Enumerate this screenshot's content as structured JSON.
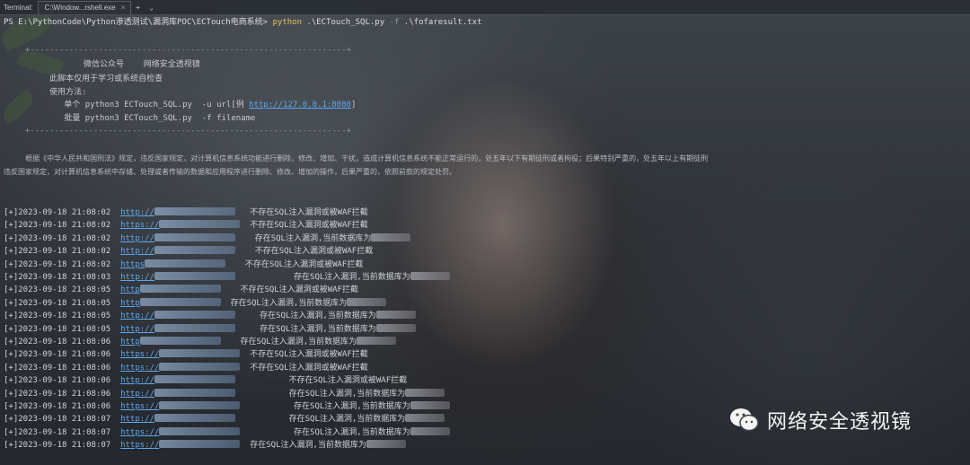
{
  "tabbar": {
    "label": "Terminal:",
    "tab_title": "C:\\Window...rshell.exe",
    "close_glyph": "×",
    "new_tab_glyph": "+",
    "dropdown_glyph": "⌄"
  },
  "command": {
    "prompt": "PS E:\\PythonCode\\Python渗透测试\\漏洞库POC\\ECTouch电商系统> ",
    "python": "python",
    "script": " .\\ECTouch_SQL.py ",
    "flag": "-f",
    "file": " .\\fofaresult.txt"
  },
  "banner": {
    "border": "+-----------------------------------------------------------------+",
    "line1": "            微信公众号    网络安全透视镜",
    "line2": "     此脚本仅用于学习或系统自检查",
    "line3": "     使用方法:",
    "line4_pre": "        单个 python3 ECTouch_SQL.py  -u url[例 ",
    "line4_link": "http://127.0.0.1:8080",
    "line4_post": "]",
    "line5": "        批量 python3 ECTouch_SQL.py  -f filename"
  },
  "legal": {
    "line1": "     根据《中华人民共和国刑法》规定，违反国家规定，对计算机信息系统功能进行删除、修改、增加、干扰，造成计算机信息系统不能正常运行的，处五年以下有期徒刑或者拘役；后果特别严重的，处五年以上有期徒刑",
    "line2": "违反国家规定，对计算机信息系统中存储、处理或者传输的数据和应用程序进行删除、修改、增加的操作，后果严重的，依照前款的规定处罚。"
  },
  "results": [
    {
      "prefix": "[+]2023-09-18 21:08:02",
      "url": "http://",
      "msg": "不存在SQL注入漏洞或被WAF拦截",
      "pad": "   "
    },
    {
      "prefix": "[+]2023-09-18 21:08:02",
      "url": "https://",
      "msg": "不存在SQL注入漏洞或被WAF拦截",
      "pad": "  "
    },
    {
      "prefix": "[+]2023-09-18 21:08:02",
      "url": "http://",
      "msg": "存在SQL注入漏洞,当前数据库为",
      "pad": "    "
    },
    {
      "prefix": "[+]2023-09-18 21:08:02",
      "url": "http://",
      "msg": "不存在SQL注入漏洞或被WAF拦截",
      "pad": "    "
    },
    {
      "prefix": "[+]2023-09-18 21:08:02",
      "url": "https",
      "msg": "不存在SQL注入漏洞或被WAF拦截",
      "pad": "    "
    },
    {
      "prefix": "[+]2023-09-18 21:08:03",
      "url": "http://",
      "msg": "存在SQL注入漏洞,当前数据库为",
      "pad": "            "
    },
    {
      "prefix": "[+]2023-09-18 21:08:05",
      "url": "http",
      "msg": "不存在SQL注入漏洞或被WAF拦截",
      "pad": "    "
    },
    {
      "prefix": "[+]2023-09-18 21:08:05",
      "url": "http",
      "msg": "存在SQL注入漏洞,当前数据库为",
      "pad": "  "
    },
    {
      "prefix": "[+]2023-09-18 21:08:05",
      "url": "http://",
      "msg": "存在SQL注入漏洞,当前数据库为",
      "pad": "     "
    },
    {
      "prefix": "[+]2023-09-18 21:08:05",
      "url": "http://",
      "msg": "存在SQL注入漏洞,当前数据库为",
      "pad": "     "
    },
    {
      "prefix": "[+]2023-09-18 21:08:06",
      "url": "http",
      "msg": "存在SQL注入漏洞,当前数据库为",
      "pad": "    "
    },
    {
      "prefix": "[+]2023-09-18 21:08:06",
      "url": "https://",
      "msg": "不存在SQL注入漏洞或被WAF拦截",
      "pad": "  "
    },
    {
      "prefix": "[+]2023-09-18 21:08:06",
      "url": "https://",
      "msg": "不存在SQL注入漏洞或被WAF拦截",
      "pad": "  "
    },
    {
      "prefix": "[+]2023-09-18 21:08:06",
      "url": "http://",
      "msg": "不存在SQL注入漏洞或被WAF拦截",
      "pad": "           "
    },
    {
      "prefix": "[+]2023-09-18 21:08:06",
      "url": "http://",
      "msg": "存在SQL注入漏洞,当前数据库为",
      "pad": "           "
    },
    {
      "prefix": "[+]2023-09-18 21:08:06",
      "url": "https://",
      "msg": "存在SQL注入漏洞,当前数据库为",
      "pad": "           "
    },
    {
      "prefix": "[+]2023-09-18 21:08:07",
      "url": "http://",
      "msg": "存在SQL注入漏洞,当前数据库为",
      "pad": "           "
    },
    {
      "prefix": "[+]2023-09-18 21:08:07",
      "url": "https://",
      "msg": "存在SQL注入漏洞,当前数据库为",
      "pad": "           "
    },
    {
      "prefix": "[+]2023-09-18 21:08:07",
      "url": "https://",
      "msg": "存在SQL注入漏洞,当前数据库为",
      "pad": "  "
    }
  ],
  "watermark": {
    "text": "网络安全透视镜",
    "icon": "wechat-icon"
  }
}
